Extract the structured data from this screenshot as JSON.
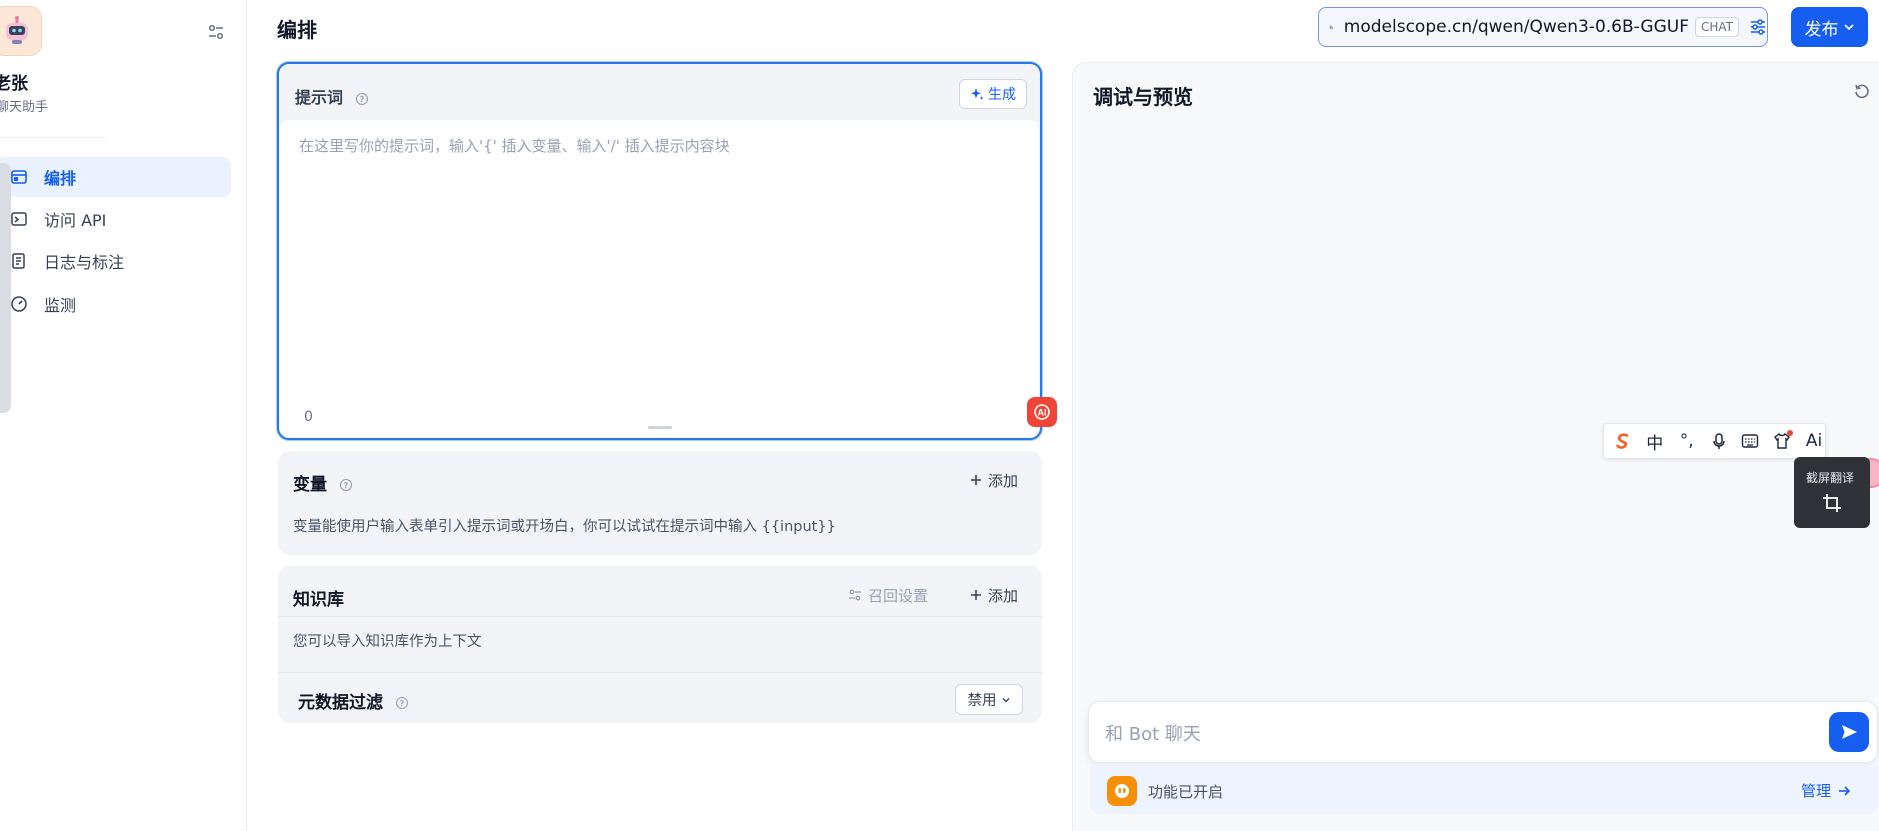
{
  "app": {
    "name": "老张",
    "name_visible": "老张",
    "description": "聊天助手"
  },
  "sidebar": {
    "items": [
      {
        "label": "编排",
        "icon": "layout-icon",
        "active": true
      },
      {
        "label": "访问 API",
        "icon": "terminal-icon",
        "active": false
      },
      {
        "label": "日志与标注",
        "icon": "log-icon",
        "active": false
      },
      {
        "label": "监测",
        "icon": "gauge-icon",
        "active": false
      }
    ]
  },
  "header": {
    "title": "编排",
    "model": {
      "name": "modelscope.cn/qwen/Qwen3-0.6B-GGUF",
      "tag": "CHAT"
    },
    "publish_label": "发布"
  },
  "prompt": {
    "label": "提示词",
    "generate_label": "生成",
    "placeholder": "在这里写你的提示词，输入'{' 插入变量、输入'/' 插入提示内容块",
    "char_count": "0"
  },
  "variables": {
    "title": "变量",
    "add_label": "添加",
    "description": "变量能使用户输入表单引入提示词或开场白，你可以试试在提示词中输入 {{input}}"
  },
  "knowledge": {
    "title": "知识库",
    "recall_label": "召回设置",
    "add_label": "添加",
    "description": "您可以导入知识库作为上下文",
    "metadata_filter_label": "元数据过滤",
    "metadata_filter_value": "禁用"
  },
  "preview": {
    "title": "调试与预览",
    "chat_placeholder": "和 Bot 聊天",
    "feature_text": "功能已开启",
    "manage_label": "管理"
  },
  "ime_toolbar": {
    "items": [
      "搜狗",
      "中",
      "°,",
      "mic",
      "keyboard",
      "shirt",
      "Ai"
    ],
    "screenshot_translate_label": "截屏翻译"
  },
  "colors": {
    "accent": "#155eef",
    "prompt_border": "#2b78e4",
    "card_bg": "#f2f4f7",
    "ai_badge": "#f04438",
    "feature_icon": "#f79009"
  }
}
